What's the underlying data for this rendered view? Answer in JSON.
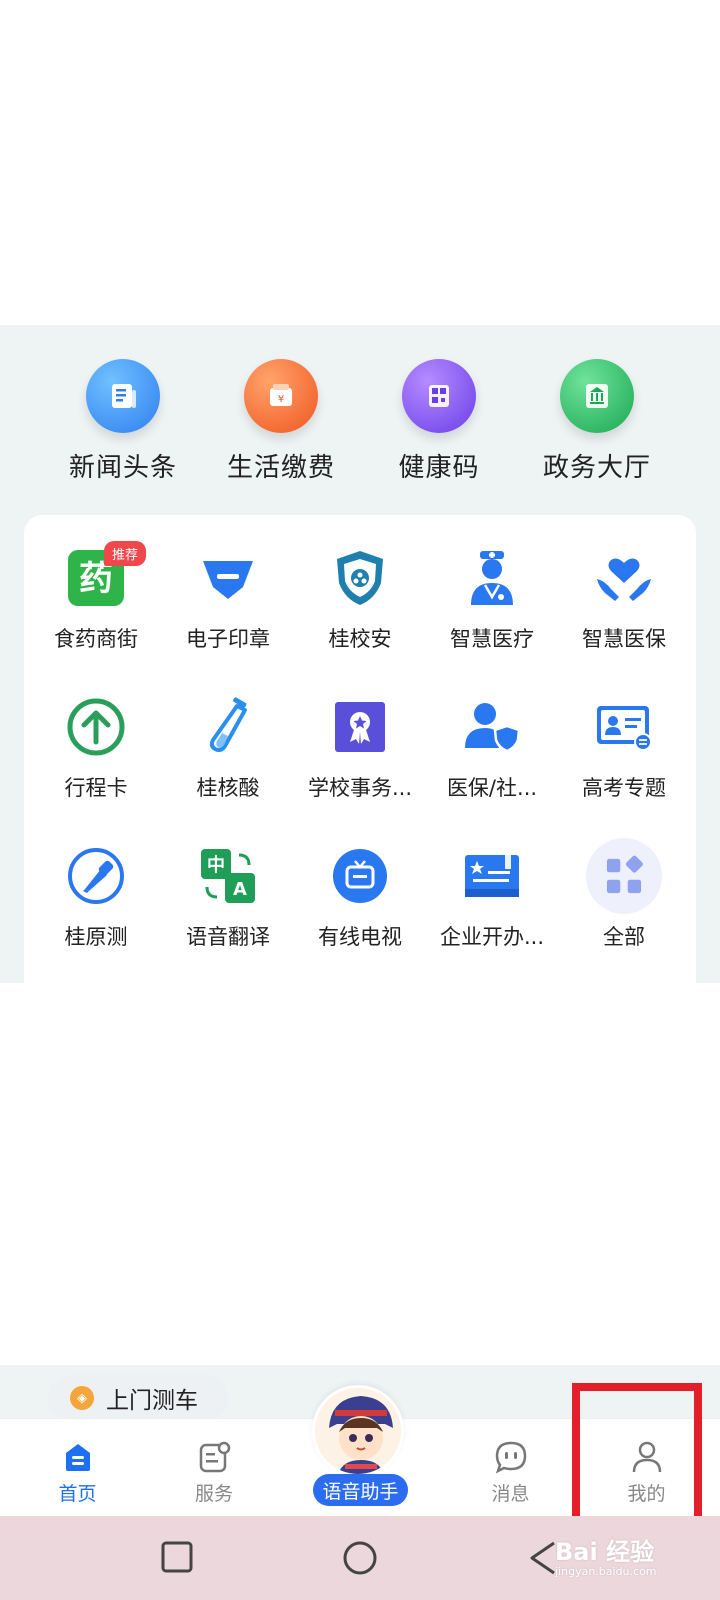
{
  "top_shortcuts": [
    {
      "label": "新闻头条",
      "icon": "news-icon",
      "color": "#2f8cf3"
    },
    {
      "label": "生活缴费",
      "icon": "payment-icon",
      "color": "#f2622a"
    },
    {
      "label": "健康码",
      "icon": "qr-code-icon",
      "color": "#7d4ef0"
    },
    {
      "label": "政务大厅",
      "icon": "government-hall-icon",
      "color": "#22b55c"
    }
  ],
  "grid_items": [
    {
      "label": "食药商街",
      "icon": "medicine-icon",
      "badge": "推荐"
    },
    {
      "label": "电子印章",
      "icon": "seal-icon"
    },
    {
      "label": "桂校安",
      "icon": "shield-icon"
    },
    {
      "label": "智慧医疗",
      "icon": "doctor-icon"
    },
    {
      "label": "智慧医保",
      "icon": "heart-hands-icon"
    },
    {
      "label": "行程卡",
      "icon": "arrow-up-circle-icon"
    },
    {
      "label": "桂核酸",
      "icon": "test-tube-icon"
    },
    {
      "label": "学校事务...",
      "icon": "certificate-icon"
    },
    {
      "label": "医保/社...",
      "icon": "user-shield-icon"
    },
    {
      "label": "高考专题",
      "icon": "id-card-icon"
    },
    {
      "label": "桂原测",
      "icon": "dropper-icon"
    },
    {
      "label": "语音翻译",
      "icon": "translate-icon"
    },
    {
      "label": "有线电视",
      "icon": "tv-icon"
    },
    {
      "label": "企业开办...",
      "icon": "business-icon"
    },
    {
      "label": "全部",
      "icon": "all-apps-icon"
    }
  ],
  "chip": {
    "label": "上门测车",
    "icon": "car-test-icon"
  },
  "bottom_nav": {
    "home": "首页",
    "services": "服务",
    "assistant": "语音助手",
    "messages": "消息",
    "mine": "我的"
  },
  "watermark": {
    "text": "Bai 经验",
    "sub": "jingyan.baidu.com"
  },
  "colors": {
    "accent": "#1f6ff2",
    "highlight": "#e3202a"
  }
}
